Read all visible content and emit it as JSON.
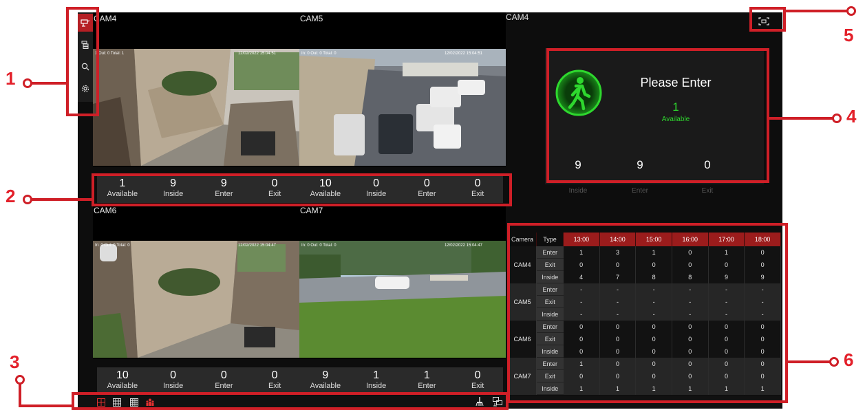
{
  "sidebar": {
    "icons": [
      "camera-live-icon",
      "playback-icon",
      "search-icon",
      "settings-icon"
    ]
  },
  "cams": {
    "cam4": {
      "label": "CAM4",
      "osd": "1 Out: 0 Total: 1",
      "timestamp": "12/02/2022 15:04:51"
    },
    "cam5": {
      "label": "CAM5",
      "osd": "In: 0 Out: 0 Total: 0",
      "timestamp": "12/02/2022 15:04:51"
    },
    "cam6": {
      "label": "CAM6",
      "osd": "In: 0 Out: 0 Total: 0",
      "timestamp": "12/02/2022 15:04:47"
    },
    "cam7": {
      "label": "CAM7",
      "osd": "In: 0 Out: 0 Total: 0",
      "timestamp": "12/02/2022 15:04:47"
    }
  },
  "stats": {
    "top_left": [
      {
        "num": "1",
        "lab": "Available"
      },
      {
        "num": "9",
        "lab": "Inside"
      },
      {
        "num": "9",
        "lab": "Enter"
      },
      {
        "num": "0",
        "lab": "Exit"
      }
    ],
    "top_right": [
      {
        "num": "10",
        "lab": "Available"
      },
      {
        "num": "0",
        "lab": "Inside"
      },
      {
        "num": "0",
        "lab": "Enter"
      },
      {
        "num": "0",
        "lab": "Exit"
      }
    ],
    "bottom_left": [
      {
        "num": "10",
        "lab": "Available"
      },
      {
        "num": "0",
        "lab": "Inside"
      },
      {
        "num": "0",
        "lab": "Enter"
      },
      {
        "num": "0",
        "lab": "Exit"
      }
    ],
    "bottom_right": [
      {
        "num": "9",
        "lab": "Available"
      },
      {
        "num": "1",
        "lab": "Inside"
      },
      {
        "num": "1",
        "lab": "Enter"
      },
      {
        "num": "0",
        "lab": "Exit"
      }
    ]
  },
  "panel": {
    "cam_label": "CAM4",
    "title": "Please Enter",
    "available_num": "1",
    "available_label": "Available",
    "inside_num": "9",
    "inside_label": "Inside",
    "enter_num": "9",
    "enter_label": "Enter",
    "exit_num": "0",
    "exit_label": "Exit"
  },
  "table": {
    "headers": [
      "Camera",
      "Type",
      "13:00",
      "14:00",
      "15:00",
      "16:00",
      "17:00",
      "18:00"
    ],
    "groups": [
      {
        "camera": "CAM4",
        "rows": [
          {
            "type": "Enter",
            "values": [
              "1",
              "3",
              "1",
              "0",
              "1",
              "0"
            ]
          },
          {
            "type": "Exit",
            "values": [
              "0",
              "0",
              "0",
              "0",
              "0",
              "0"
            ]
          },
          {
            "type": "Inside",
            "values": [
              "4",
              "7",
              "8",
              "8",
              "9",
              "9"
            ]
          }
        ]
      },
      {
        "camera": "CAM5",
        "rows": [
          {
            "type": "Enter",
            "values": [
              "-",
              "-",
              "-",
              "-",
              "-",
              "-"
            ]
          },
          {
            "type": "Exit",
            "values": [
              "-",
              "-",
              "-",
              "-",
              "-",
              "-"
            ]
          },
          {
            "type": "Inside",
            "values": [
              "-",
              "-",
              "-",
              "-",
              "-",
              "-"
            ]
          }
        ]
      },
      {
        "camera": "CAM6",
        "rows": [
          {
            "type": "Enter",
            "values": [
              "0",
              "0",
              "0",
              "0",
              "0",
              "0"
            ]
          },
          {
            "type": "Exit",
            "values": [
              "0",
              "0",
              "0",
              "0",
              "0",
              "0"
            ]
          },
          {
            "type": "Inside",
            "values": [
              "0",
              "0",
              "0",
              "0",
              "0",
              "0"
            ]
          }
        ]
      },
      {
        "camera": "CAM7",
        "rows": [
          {
            "type": "Enter",
            "values": [
              "1",
              "0",
              "0",
              "0",
              "0",
              "0"
            ]
          },
          {
            "type": "Exit",
            "values": [
              "0",
              "0",
              "0",
              "0",
              "0",
              "0"
            ]
          },
          {
            "type": "Inside",
            "values": [
              "1",
              "1",
              "1",
              "1",
              "1",
              "1"
            ]
          }
        ]
      }
    ]
  },
  "toolbar": {
    "left_icons": [
      "layout-4-icon",
      "layout-9-icon",
      "layout-16-icon",
      "people-count-icon"
    ],
    "right_icons": [
      "clear-icon",
      "screen-toggle-icon"
    ]
  },
  "annotations": {
    "n1": "1",
    "n2": "2",
    "n3": "3",
    "n4": "4",
    "n5": "5",
    "n6": "6"
  },
  "colors": {
    "accent_red": "#cf1f27",
    "green": "#2ed82e",
    "header_red": "#9b1c1c"
  }
}
